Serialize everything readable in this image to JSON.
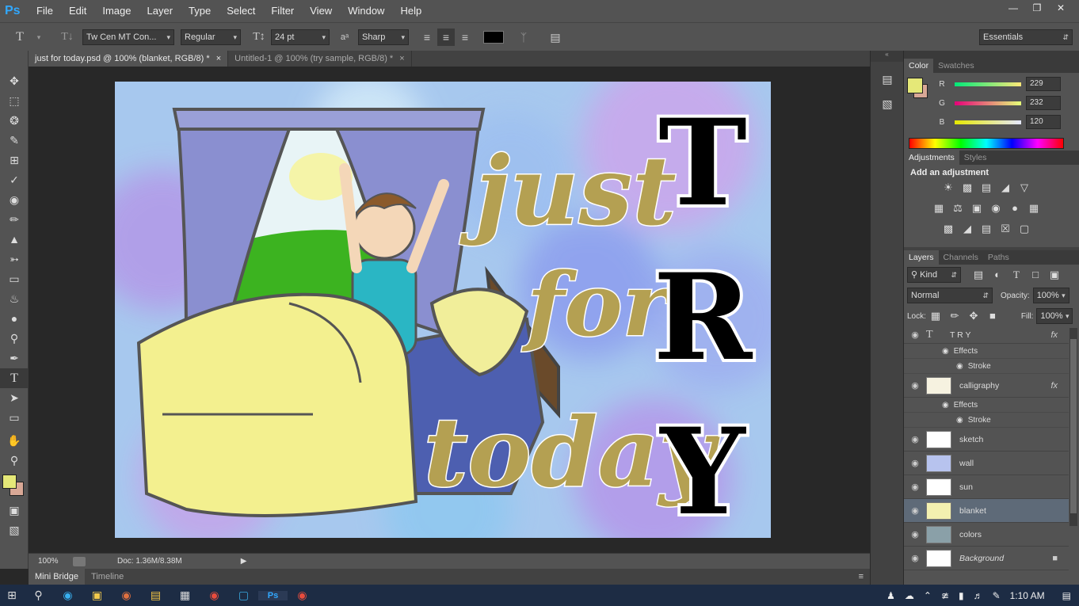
{
  "app": {
    "logo": "Ps"
  },
  "menu": [
    "File",
    "Edit",
    "Image",
    "Layer",
    "Type",
    "Select",
    "Filter",
    "View",
    "Window",
    "Help"
  ],
  "options": {
    "font_family": "Tw Cen MT Con...",
    "font_style": "Regular",
    "font_size": "24 pt",
    "antialias": "Sharp",
    "workspace": "Essentials"
  },
  "tabs": [
    {
      "label": "just for today.psd @ 100% (blanket, RGB/8) *",
      "close": "×"
    },
    {
      "label": "Untitled-1 @ 100% (try sample, RGB/8) *",
      "close": "×"
    }
  ],
  "artwork": {
    "script_lines": [
      "just",
      "for",
      "today"
    ],
    "block_letters": [
      "T",
      "R",
      "Y"
    ]
  },
  "status": {
    "zoom": "100%",
    "doc_info": "Doc: 1.36M/8.38M"
  },
  "bottom_tabs": [
    "Mini Bridge",
    "Timeline"
  ],
  "color_panel": {
    "tabs": [
      "Color",
      "Swatches"
    ],
    "foreground_color": "#e5e878",
    "background_color": "#d9a896",
    "channels": [
      {
        "label": "R",
        "value": "229"
      },
      {
        "label": "G",
        "value": "232"
      },
      {
        "label": "B",
        "value": "120"
      }
    ]
  },
  "adjustments_panel": {
    "tabs": [
      "Adjustments",
      "Styles"
    ],
    "title": "Add an adjustment"
  },
  "layers_panel": {
    "tabs": [
      "Layers",
      "Channels",
      "Paths"
    ],
    "filter_kind": "Kind",
    "blend_mode": "Normal",
    "opacity_label": "Opacity:",
    "opacity": "100%",
    "lock_label": "Lock:",
    "fill_label": "Fill:",
    "fill": "100%",
    "layers": [
      {
        "name": "T R Y",
        "fx": "fx",
        "effects": "Effects",
        "stroke": "Stroke"
      },
      {
        "name": "calligraphy",
        "fx": "fx",
        "effects": "Effects",
        "stroke": "Stroke"
      },
      {
        "name": "sketch"
      },
      {
        "name": "wall"
      },
      {
        "name": "sun"
      },
      {
        "name": "blanket"
      },
      {
        "name": "colors"
      },
      {
        "name": "Background"
      }
    ]
  },
  "taskbar": {
    "time": "1:10 AM"
  }
}
